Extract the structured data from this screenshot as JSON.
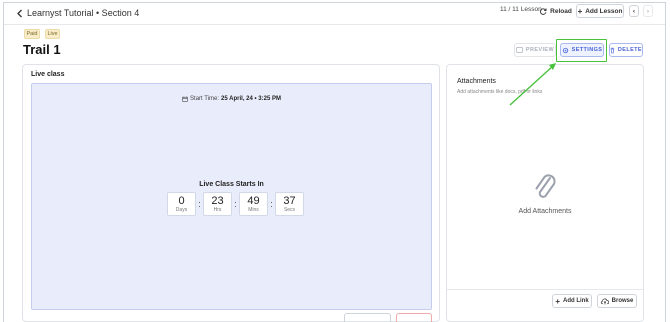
{
  "header": {
    "back_label": "Learnyst Tutorial • Section 4",
    "lesson_count": "11 / 11 Lesson",
    "reload_label": "Reload",
    "add_lesson_label": "Add Lesson",
    "prev_glyph": "‹",
    "next_glyph": "›"
  },
  "lesson": {
    "tags": [
      "Paid",
      "Live"
    ],
    "title": "Trail 1",
    "actions": {
      "preview": "PREVIEW",
      "settings": "SETTINGS",
      "delete": "DELETE"
    }
  },
  "live_class": {
    "title": "Live class",
    "start_time_label": "Start Time:",
    "start_time_value": "25 April, 24 • 3:25 PM",
    "starts_in_label": "Live Class Starts In",
    "countdown": [
      {
        "value": "0",
        "label": "Days"
      },
      {
        "value": "23",
        "label": "Hrs"
      },
      {
        "value": "49",
        "label": "Mins"
      },
      {
        "value": "37",
        "label": "Secs"
      }
    ]
  },
  "attachments": {
    "title": "Attachments",
    "subtitle": "Add attachments like docs, pdf or links",
    "empty_label": "Add Attachments",
    "add_link_label": "Add Link",
    "browse_label": "Browse"
  },
  "colors": {
    "accent": "#4a63d8",
    "highlight": "#48c23c",
    "stage_bg": "#e9edfb",
    "tag_bg": "#f9edc9"
  },
  "icons": [
    "chevron-left-icon",
    "reload-icon",
    "plus-icon",
    "preview-icon",
    "gear-icon",
    "trash-icon",
    "calendar-icon",
    "paperclip-icon",
    "cloud-upload-icon"
  ]
}
